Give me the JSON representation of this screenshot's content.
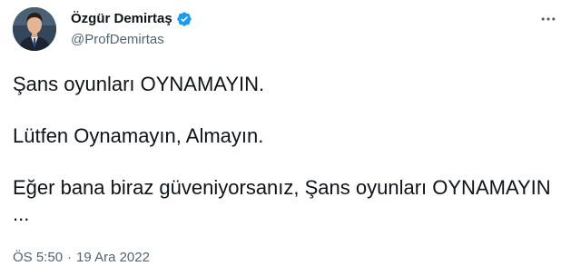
{
  "author": {
    "name": "Özgür Demirtaş",
    "handle": "@ProfDemirtas",
    "verified": true,
    "verified_color": "#1d9bf0"
  },
  "tweet": {
    "paragraphs": [
      "Şans oyunları OYNAMAYIN.",
      "Lütfen Oynamayın, Almayın.",
      "Eğer bana biraz güveniyorsanız, Şans oyunları OYNAMAYIN ..."
    ]
  },
  "meta": {
    "time": "ÖS 5:50",
    "separator": "·",
    "date": "19 Ara 2022"
  },
  "icons": {
    "more": "more-horizontal-icon",
    "verified": "verified-badge-icon"
  },
  "colors": {
    "text": "#0f1419",
    "secondary": "#536471",
    "accent": "#1d9bf0"
  }
}
